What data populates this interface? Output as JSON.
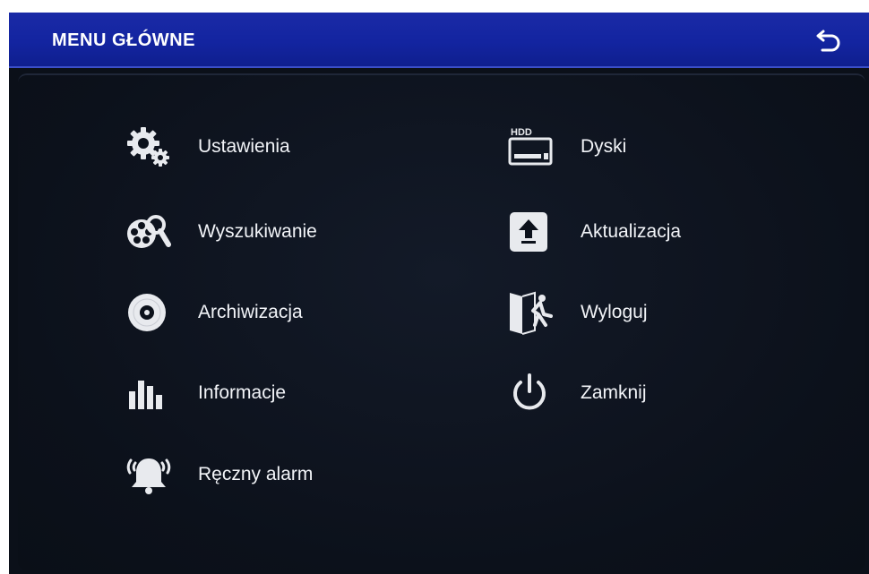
{
  "window": {
    "title": "MENU GŁÓWNE",
    "back_icon": "return-arrow-icon"
  },
  "menu": {
    "left": [
      {
        "label": "Ustawienia",
        "icon": "gears-icon"
      },
      {
        "label": "Wyszukiwanie",
        "icon": "film-reel-search-icon"
      },
      {
        "label": "Archiwizacja",
        "icon": "disc-icon"
      },
      {
        "label": "Informacje",
        "icon": "bar-chart-icon"
      },
      {
        "label": "Ręczny alarm",
        "icon": "alarm-bell-icon"
      }
    ],
    "right": [
      {
        "label": "Dyski",
        "icon": "hdd-icon",
        "icon_text": "HDD"
      },
      {
        "label": "Aktualizacja",
        "icon": "upload-arrow-icon"
      },
      {
        "label": "Wyloguj",
        "icon": "exit-door-icon"
      },
      {
        "label": "Zamknij",
        "icon": "power-icon"
      }
    ]
  },
  "colors": {
    "titlebar": "#1324a0",
    "background": "#0b1019",
    "text": "#f2f4f8"
  }
}
